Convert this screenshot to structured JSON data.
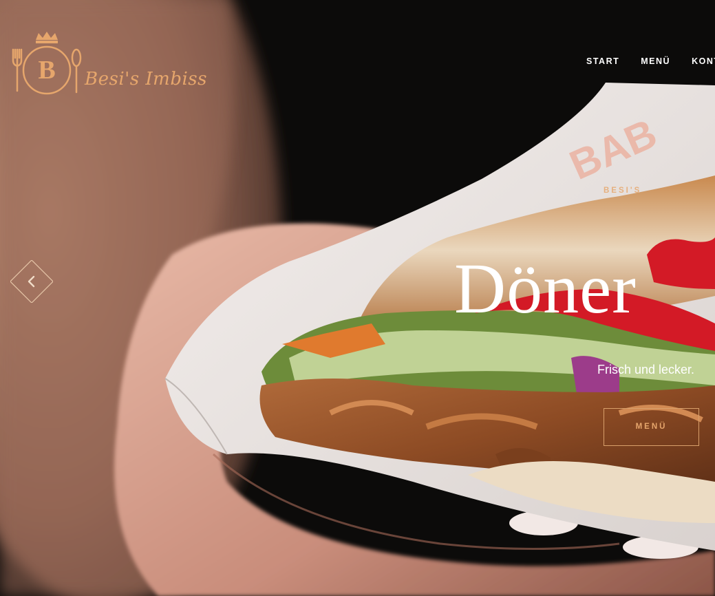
{
  "brand": {
    "logo_letter": "B",
    "logo_script": "Besi's Imbiss",
    "accent_color": "#e6a66c"
  },
  "nav": {
    "items": [
      "START",
      "MENÜ",
      "KONT"
    ]
  },
  "hero": {
    "eyebrow": "BESI'S",
    "headline": "Döner",
    "subline": "Frisch und lecker.",
    "cta_label": "MENÜ",
    "prev_icon": "chevron-left-icon",
    "wrapper_print": "BAB"
  }
}
